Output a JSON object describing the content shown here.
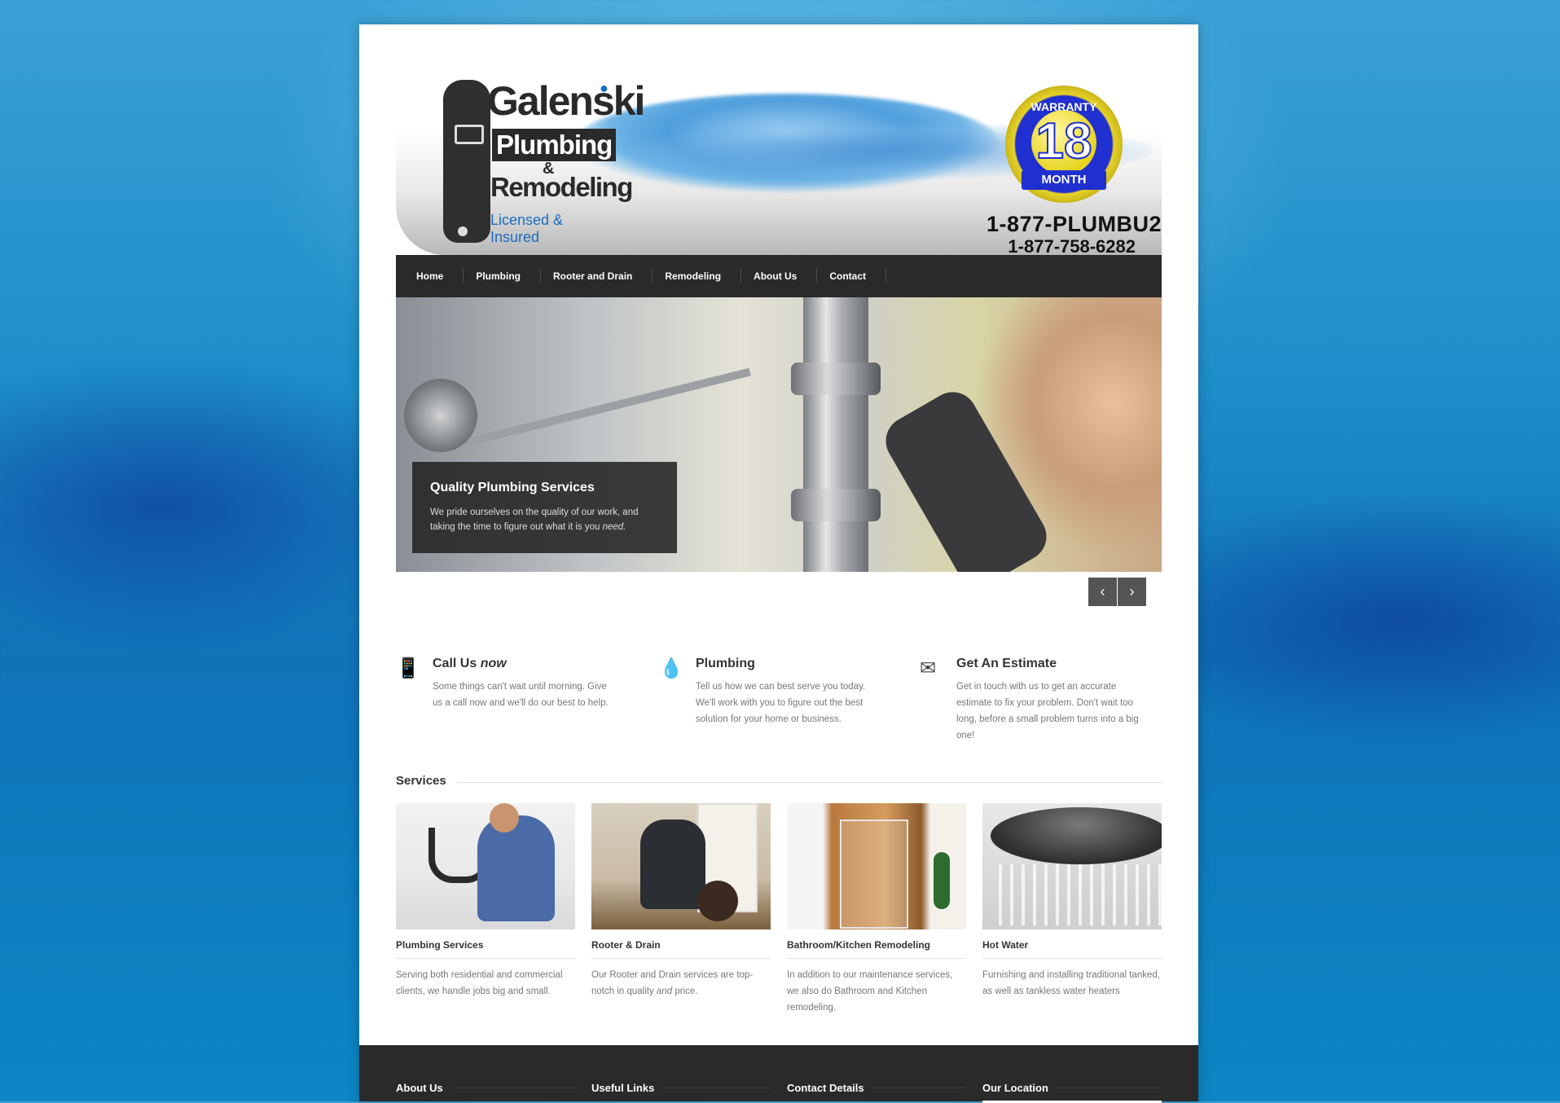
{
  "header": {
    "logo": {
      "name": "Galenski",
      "line2": "Plumbing",
      "amp": "&",
      "line3": "Remodeling",
      "tagline": "Licensed & Insured"
    },
    "badge": {
      "top": "WARRANTY",
      "number": "18",
      "bottom": "MONTH"
    },
    "phone_vanity": "1-877-PLUMBU2",
    "phone_numeric": "1-877-758-6282"
  },
  "nav": {
    "items": [
      {
        "label": "Home"
      },
      {
        "label": "Plumbing"
      },
      {
        "label": "Rooter and Drain"
      },
      {
        "label": "Remodeling"
      },
      {
        "label": "About Us"
      },
      {
        "label": "Contact"
      }
    ]
  },
  "hero": {
    "title": "Quality Plumbing Services",
    "text": "We pride ourselves on the quality of our work, and taking the time to figure out what it is you",
    "text_em": "need.",
    "prev_icon": "‹",
    "next_icon": "›"
  },
  "features": [
    {
      "icon": "phone-icon",
      "glyph": "📱",
      "title": "Call Us",
      "title_em": "now",
      "text": "Some things can't wait until morning. Give us a call now and we'll do our best to help."
    },
    {
      "icon": "water-drops-icon",
      "glyph": "💧",
      "title": "Plumbing",
      "title_em": "",
      "text": "Tell us how we can best serve you today. We'll work with you to figure out the best solution for your home or business."
    },
    {
      "icon": "envelope-icon",
      "glyph": "✉",
      "title": "Get An Estimate",
      "title_em": "",
      "text": "Get in touch with us to get an accurate estimate to fix your problem. Don't wait too long, before a small problem turns into a big one!"
    }
  ],
  "services": {
    "heading": "Services",
    "items": [
      {
        "title": "Plumbing Services",
        "text": "Serving both residential and commercial clients, we handle jobs big and small.",
        "text_em": "",
        "text_after": ""
      },
      {
        "title": "Rooter & Drain",
        "text": "Our Rooter and Drain services are top-notch in quality",
        "text_em": "and",
        "text_after": "price."
      },
      {
        "title": "Bathroom/Kitchen Remodeling",
        "text": "In addition to our maintenance services, we also do Bathroom and Kitchen remodeling.",
        "text_em": "",
        "text_after": ""
      },
      {
        "title": "Hot Water",
        "text": "Furnishing and installing traditional tanked, as well as tankless water heaters",
        "text_em": "",
        "text_after": ""
      }
    ]
  },
  "footer": {
    "columns": [
      {
        "title": "About Us"
      },
      {
        "title": "Useful Links"
      },
      {
        "title": "Contact Details"
      },
      {
        "title": "Our Location"
      }
    ]
  }
}
